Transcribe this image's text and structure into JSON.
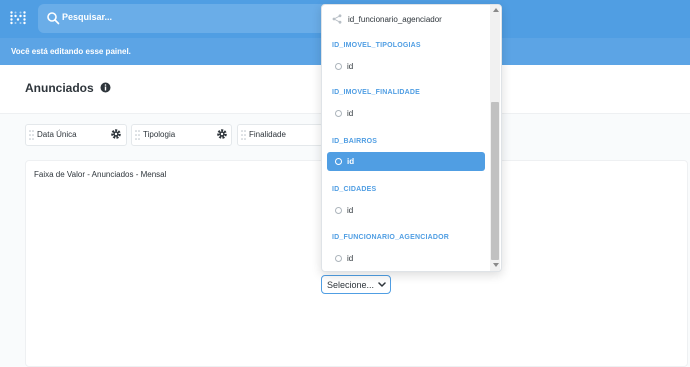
{
  "topbar": {
    "search_placeholder": "Pesquisar...",
    "logo_icon": "metabase-logo-icon",
    "search_icon": "search-icon"
  },
  "banner": {
    "text": "Você está editando esse painel."
  },
  "dashboard": {
    "title": "Anunciados",
    "info_icon": "info-icon"
  },
  "filters": [
    {
      "label": "Data Única"
    },
    {
      "label": "Tipologia"
    },
    {
      "label": "Finalidade"
    }
  ],
  "card": {
    "title": "Faixa de Valor - Anunciados - Mensal",
    "select_label": "Selecione..."
  },
  "dropdown": {
    "top_item": "id_funcionario_agenciador",
    "sections": [
      {
        "title": "ID_IMOVEL_TIPOLOGIAS",
        "item": "id",
        "selected": false
      },
      {
        "title": "ID_IMOVEL_FINALIDADE",
        "item": "id",
        "selected": false
      },
      {
        "title": "ID_BAIRROS",
        "item": "id",
        "selected": true
      },
      {
        "title": "ID_CIDADES",
        "item": "id",
        "selected": false
      },
      {
        "title": "ID_FUNCIONARIO_AGENCIADOR",
        "item": "id",
        "selected": false
      }
    ]
  },
  "colors": {
    "brand": "#509ee3",
    "banner": "#5ca4e5",
    "text": "#2e353b"
  }
}
